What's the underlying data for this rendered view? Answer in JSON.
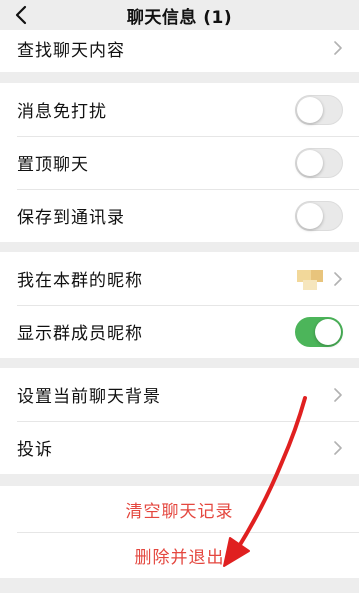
{
  "header": {
    "title": "聊天信息 (1)",
    "back_icon": "chevron-left-icon"
  },
  "search_section": {
    "label": "查找聊天内容"
  },
  "settings_section": {
    "items": [
      {
        "label": "消息免打扰",
        "toggle": "off"
      },
      {
        "label": "置顶聊天",
        "toggle": "off"
      },
      {
        "label": "保存到通讯录",
        "toggle": "off"
      }
    ]
  },
  "nickname_section": {
    "my_nickname_label": "我在本群的昵称",
    "show_nicknames_label": "显示群成员昵称",
    "show_nicknames_toggle": "on"
  },
  "misc_section": {
    "background_label": "设置当前聊天背景",
    "complaint_label": "投诉"
  },
  "actions": {
    "clear_history": "清空聊天记录",
    "delete_and_exit": "删除并退出"
  },
  "colors": {
    "background": "#ededed",
    "toggle_on": "#4cb55a",
    "danger_text": "#e4473f",
    "annotation_arrow": "#e02020"
  }
}
